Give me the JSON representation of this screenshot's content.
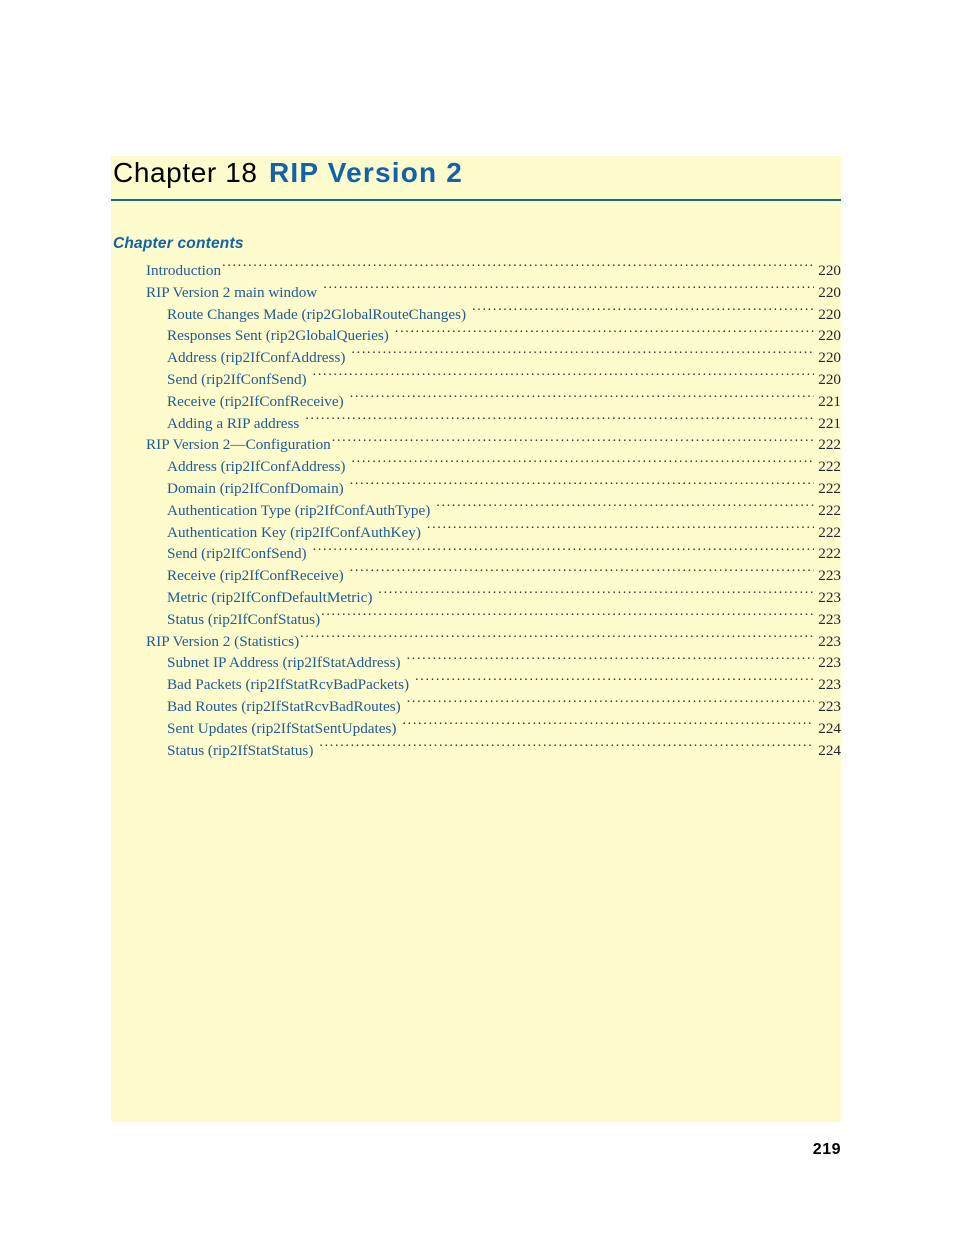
{
  "chapter": {
    "number_label": "Chapter 18",
    "title": "RIP Version 2",
    "rule_color": "#136a8e",
    "title_color": "#1063ab"
  },
  "contents": {
    "heading": "Chapter contents",
    "entries": [
      {
        "label": "Introduction",
        "page": "220",
        "level": 1,
        "tight": true
      },
      {
        "label": "RIP Version 2 main window",
        "page": "220",
        "level": 1,
        "tight": false
      },
      {
        "label": "Route Changes Made (rip2GlobalRouteChanges)",
        "page": "220",
        "level": 2,
        "tight": false
      },
      {
        "label": "Responses Sent (rip2GlobalQueries)",
        "page": "220",
        "level": 2,
        "tight": false
      },
      {
        "label": "Address (rip2IfConfAddress)",
        "page": "220",
        "level": 2,
        "tight": false
      },
      {
        "label": "Send (rip2IfConfSend)",
        "page": "220",
        "level": 2,
        "tight": false
      },
      {
        "label": "Receive (rip2IfConfReceive)",
        "page": "221",
        "level": 2,
        "tight": false
      },
      {
        "label": "Adding a RIP address",
        "page": "221",
        "level": 2,
        "tight": false
      },
      {
        "label": "RIP Version 2—Configuration",
        "page": "222",
        "level": 1,
        "tight": true
      },
      {
        "label": "Address (rip2IfConfAddress)",
        "page": "222",
        "level": 2,
        "tight": false
      },
      {
        "label": "Domain (rip2IfConfDomain)",
        "page": "222",
        "level": 2,
        "tight": false
      },
      {
        "label": "Authentication Type (rip2IfConfAuthType)",
        "page": "222",
        "level": 2,
        "tight": false
      },
      {
        "label": "Authentication Key (rip2IfConfAuthKey)",
        "page": "222",
        "level": 2,
        "tight": false
      },
      {
        "label": "Send (rip2IfConfSend)",
        "page": "222",
        "level": 2,
        "tight": false
      },
      {
        "label": "Receive (rip2IfConfReceive)",
        "page": "223",
        "level": 2,
        "tight": false
      },
      {
        "label": "Metric (rip2IfConfDefaultMetric)",
        "page": "223",
        "level": 2,
        "tight": false
      },
      {
        "label": "Status (rip2IfConfStatus)",
        "page": "223",
        "level": 2,
        "tight": true
      },
      {
        "label": "RIP Version 2 (Statistics)",
        "page": "223",
        "level": 1,
        "tight": true
      },
      {
        "label": "Subnet IP Address (rip2IfStatAddress)",
        "page": "223",
        "level": 2,
        "tight": false
      },
      {
        "label": "Bad Packets (rip2IfStatRcvBadPackets)",
        "page": "223",
        "level": 2,
        "tight": false
      },
      {
        "label": "Bad Routes (rip2IfStatRcvBadRoutes)",
        "page": "223",
        "level": 2,
        "tight": false
      },
      {
        "label": "Sent Updates (rip2IfStatSentUpdates)",
        "page": "224",
        "level": 2,
        "tight": false
      },
      {
        "label": "Status (rip2IfStatStatus)",
        "page": "224",
        "level": 2,
        "tight": false
      }
    ]
  },
  "folio": {
    "page_number": "219"
  }
}
